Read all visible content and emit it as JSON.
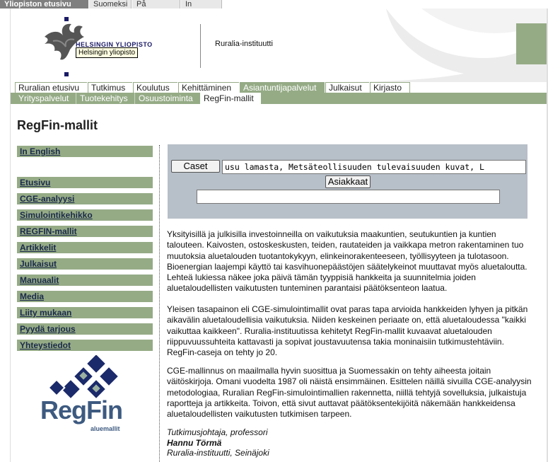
{
  "langbar": {
    "home": "Yliopiston etusivu",
    "finnish": "Suomeksi",
    "swedish": "På svenska",
    "english": "In English"
  },
  "header": {
    "university_name": "HELSINGIN YLIOPISTO",
    "tooltip": "Helsingin yliopisto",
    "institute": "Ruralia-instituutti"
  },
  "nav_main": [
    "Ruralian etusivu",
    "Tutkimus",
    "Koulutus",
    "Kehittäminen",
    "Asiantuntijapalvelut",
    "Julkaisut",
    "Kirjasto"
  ],
  "nav_sub": [
    "Yrityspalvelut",
    "Tuotekehitys",
    "Osuustoiminta",
    "RegFin-mallit"
  ],
  "page_title": "RegFin-mallit",
  "sidebar": {
    "in_english": "In English",
    "items": [
      "Etusivu",
      "CGE-analyysi",
      "Simulointikehikko",
      "REGFIN-mallit",
      "Artikkelit",
      "Julkaisut",
      "Manuaalit",
      "Media",
      "Liity mukaan",
      "Pyydä tarjous",
      "Yhteystiedot"
    ]
  },
  "logo": {
    "text": "RegFin",
    "subtext": "aluemallit"
  },
  "search": {
    "caset_label": "Caset",
    "case_value": "usu lamasta, Metsäteollisuuden tulevaisuuden kuvat, L",
    "clients_label": "Asiakkaat",
    "client_value": ""
  },
  "content": {
    "p1": "Yksityisillä ja julkisilla investoinneilla on vaikutuksia maakuntien, seutukuntien ja kuntien talouteen. Kaivosten, ostoskeskusten, teiden, rautateiden ja vaikkapa metron rakentaminen tuo muutoksia aluetalouden tuotantokykyyn, elinkeinorakenteeseen, työllisyyteen ja tulotasoon. Bioenergian laajempi käyttö tai kasvihuonepäästöjen säätelykeinot muuttavat myös aluetaloutta. Lehteä lukiessa näkee joka päivä tämän tyyppisiä hankkeita ja suunnitelmia joiden aluetaloudellisten vaikutusten tunteminen parantaisi päätöksenteon laatua.",
    "p2": "Yleisen tasapainon eli CGE-simulointimallit ovat paras tapa arvioida hankkeiden lyhyen ja pitkän aikavälin aluetaloudellisia vaikutuksia. Niiden keskeinen periaate on, että aluetaloudessa \"kaikki vaikuttaa kaikkeen\". Ruralia-instituutissa kehitetyt RegFin-mallit kuvaavat aluetalouden riippuvuussuhteita kattavasti ja sopivat joustavuutensa takia moninaisiin tutkimustehtäviin. RegFin-caseja on tehty jo 20.",
    "p3": "CGE-mallinnus on maailmalla hyvin suosittua ja Suomessakin on tehty aiheesta joitain väitöskirjoja. Omani vuodelta 1987 oli näistä ensimmäinen. Esittelen näillä sivuilla CGE-analyysin metodologiaa, Ruralian RegFin-simulointimallien rakennetta, niillä tehtyjä sovelluksia, julkaistuja raportteja ja artikkeita. Toivon, että sivut auttavat päätöksentekijöitä näkemään hankkeidensa aluetaloudellisten vaikutusten tutkimisen tarpeen.",
    "signature_role": "Tutkimusjohtaja, professori",
    "signature_name": "Hannu Törmä",
    "signature_org": "Ruralia-instituutti, Seinäjoki"
  },
  "colors": {
    "green": "#95ab86",
    "panel": "#b7bfc8",
    "navy": "#1b2a4a"
  }
}
